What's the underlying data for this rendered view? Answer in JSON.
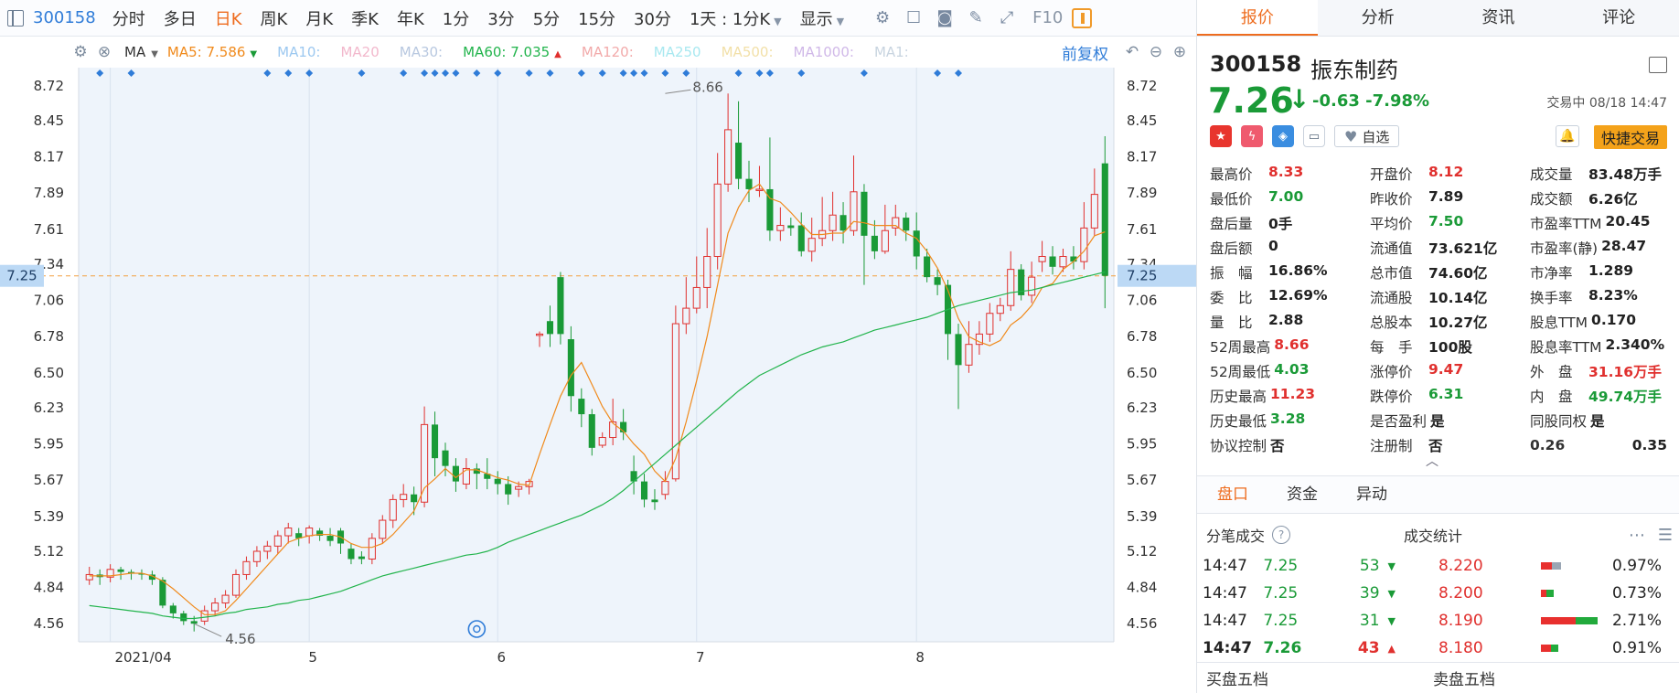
{
  "toolbar": {
    "code": "300158",
    "timeframes": [
      {
        "label": "分时",
        "active": false
      },
      {
        "label": "多日",
        "active": false
      },
      {
        "label": "日K",
        "active": true
      },
      {
        "label": "周K",
        "active": false
      },
      {
        "label": "月K",
        "active": false
      },
      {
        "label": "季K",
        "active": false
      },
      {
        "label": "年K",
        "active": false
      },
      {
        "label": "1分",
        "active": false
      },
      {
        "label": "3分",
        "active": false
      },
      {
        "label": "5分",
        "active": false
      },
      {
        "label": "15分",
        "active": false
      },
      {
        "label": "30分",
        "active": false
      }
    ],
    "period_select": "1天 : 1分K",
    "display_label": "显示",
    "f10": "F10"
  },
  "ma_bar": {
    "indicator": "MA",
    "items": [
      {
        "label": "MA5: 7.586",
        "color": "#f08a1c",
        "arrow": "down"
      },
      {
        "label": "MA10:",
        "color": "#9cc8f0"
      },
      {
        "label": "MA20",
        "color": "#f2b8cc"
      },
      {
        "label": "MA30:",
        "color": "#b8c8e0"
      },
      {
        "label": "MA60: 7.035",
        "color": "#22b44c",
        "arrow": "up"
      },
      {
        "label": "MA120:",
        "color": "#f2aaaa"
      },
      {
        "label": "MA250",
        "color": "#a8e8f0"
      },
      {
        "label": "MA500:",
        "color": "#f2e0a8"
      },
      {
        "label": "MA1000:",
        "color": "#d0b8e8"
      },
      {
        "label": "MA1:",
        "color": "#c8d4e0"
      }
    ],
    "adjust_label": "前复权"
  },
  "chart_data": {
    "type": "candlestick",
    "y_ticks": [
      "8.72",
      "8.45",
      "8.17",
      "7.89",
      "7.61",
      "7.34",
      "7.06",
      "6.78",
      "6.50",
      "6.23",
      "5.95",
      "5.67",
      "5.39",
      "5.12",
      "4.84",
      "4.56"
    ],
    "ylim": [
      4.42,
      8.86
    ],
    "x_labels": [
      {
        "label": "2021/04",
        "idx": 2
      },
      {
        "label": "5",
        "idx": 21
      },
      {
        "label": "6",
        "idx": 39
      },
      {
        "label": "7",
        "idx": 58
      },
      {
        "label": "8",
        "idx": 79
      }
    ],
    "current_price": "7.25",
    "current_value": 7.25,
    "high_label": "8.66",
    "high_value": 8.66,
    "high_idx": 55,
    "low_label": "4.56",
    "low_value": 4.56,
    "low_idx": 10,
    "candles": [
      [
        4.9,
        4.94,
        4.86,
        5.0
      ],
      [
        4.94,
        4.92,
        4.86,
        4.98
      ],
      [
        4.92,
        4.98,
        4.88,
        5.02
      ],
      [
        4.98,
        4.96,
        4.9,
        5.0
      ],
      [
        4.96,
        4.95,
        4.9,
        4.98
      ],
      [
        4.95,
        4.94,
        4.9,
        4.98
      ],
      [
        4.94,
        4.9,
        4.86,
        4.97
      ],
      [
        4.9,
        4.7,
        4.68,
        4.92
      ],
      [
        4.7,
        4.64,
        4.6,
        4.72
      ],
      [
        4.64,
        4.58,
        4.55,
        4.66
      ],
      [
        4.58,
        4.56,
        4.5,
        4.62
      ],
      [
        4.58,
        4.66,
        4.55,
        4.7
      ],
      [
        4.66,
        4.72,
        4.62,
        4.76
      ],
      [
        4.72,
        4.78,
        4.68,
        4.82
      ],
      [
        4.78,
        4.94,
        4.76,
        4.98
      ],
      [
        4.94,
        5.04,
        4.9,
        5.08
      ],
      [
        5.04,
        5.12,
        5.0,
        5.16
      ],
      [
        5.12,
        5.16,
        5.06,
        5.2
      ],
      [
        5.16,
        5.24,
        5.1,
        5.28
      ],
      [
        5.24,
        5.3,
        5.18,
        5.34
      ],
      [
        5.26,
        5.22,
        5.16,
        5.3
      ],
      [
        5.24,
        5.3,
        5.18,
        5.32
      ],
      [
        5.28,
        5.24,
        5.2,
        5.3
      ],
      [
        5.24,
        5.2,
        5.16,
        5.3
      ],
      [
        5.28,
        5.18,
        5.1,
        5.3
      ],
      [
        5.14,
        5.06,
        5.02,
        5.18
      ],
      [
        5.08,
        5.06,
        5.02,
        5.12
      ],
      [
        5.06,
        5.22,
        5.02,
        5.26
      ],
      [
        5.22,
        5.36,
        5.18,
        5.4
      ],
      [
        5.36,
        5.52,
        5.3,
        5.56
      ],
      [
        5.52,
        5.56,
        5.46,
        5.64
      ],
      [
        5.56,
        5.5,
        5.4,
        5.62
      ],
      [
        5.5,
        6.1,
        5.46,
        6.24
      ],
      [
        6.1,
        5.84,
        5.7,
        6.2
      ],
      [
        5.9,
        5.78,
        5.7,
        5.96
      ],
      [
        5.78,
        5.66,
        5.58,
        5.84
      ],
      [
        5.64,
        5.76,
        5.6,
        5.84
      ],
      [
        5.76,
        5.72,
        5.6,
        5.8
      ],
      [
        5.72,
        5.68,
        5.6,
        5.84
      ],
      [
        5.68,
        5.64,
        5.56,
        5.74
      ],
      [
        5.64,
        5.56,
        5.48,
        5.7
      ],
      [
        5.6,
        5.62,
        5.54,
        5.66
      ],
      [
        5.62,
        5.66,
        5.56,
        5.68
      ],
      [
        6.8,
        6.8,
        6.7,
        6.82
      ],
      [
        6.9,
        6.8,
        6.7,
        7.02
      ],
      [
        7.24,
        6.8,
        6.72,
        7.28
      ],
      [
        6.76,
        6.32,
        6.2,
        6.86
      ],
      [
        6.3,
        6.18,
        6.08,
        6.38
      ],
      [
        6.18,
        5.92,
        5.86,
        6.22
      ],
      [
        5.94,
        6.0,
        5.92,
        6.04
      ],
      [
        6.0,
        6.12,
        5.94,
        6.3
      ],
      [
        6.12,
        6.04,
        5.98,
        6.22
      ],
      [
        5.74,
        5.66,
        5.56,
        5.86
      ],
      [
        5.66,
        5.52,
        5.46,
        5.72
      ],
      [
        5.52,
        5.5,
        5.44,
        5.6
      ],
      [
        5.56,
        5.66,
        5.52,
        5.74
      ],
      [
        5.68,
        6.88,
        5.66,
        7.02
      ],
      [
        6.88,
        7.0,
        6.8,
        7.24
      ],
      [
        7.0,
        7.16,
        6.96,
        7.4
      ],
      [
        7.16,
        7.4,
        7.0,
        7.62
      ],
      [
        7.4,
        7.96,
        7.3,
        8.2
      ],
      [
        7.96,
        8.38,
        7.9,
        8.66
      ],
      [
        8.28,
        8.0,
        7.92,
        8.6
      ],
      [
        8.0,
        7.92,
        7.82,
        8.14
      ],
      [
        7.92,
        7.92,
        7.86,
        8.1
      ],
      [
        7.92,
        7.6,
        7.52,
        8.32
      ],
      [
        7.6,
        7.64,
        7.52,
        7.78
      ],
      [
        7.64,
        7.62,
        7.56,
        7.7
      ],
      [
        7.64,
        7.44,
        7.4,
        7.74
      ],
      [
        7.44,
        7.54,
        7.36,
        7.7
      ],
      [
        7.54,
        7.6,
        7.48,
        7.86
      ],
      [
        7.6,
        7.72,
        7.52,
        7.9
      ],
      [
        7.72,
        7.6,
        7.5,
        7.82
      ],
      [
        7.6,
        7.9,
        7.56,
        8.18
      ],
      [
        7.9,
        7.56,
        7.18,
        7.96
      ],
      [
        7.56,
        7.44,
        7.38,
        7.68
      ],
      [
        7.44,
        7.6,
        7.42,
        7.8
      ],
      [
        7.62,
        7.7,
        7.56,
        7.8
      ],
      [
        7.7,
        7.6,
        7.52,
        7.74
      ],
      [
        7.6,
        7.4,
        7.3,
        7.74
      ],
      [
        7.4,
        7.24,
        7.2,
        7.46
      ],
      [
        7.24,
        7.18,
        7.1,
        7.3
      ],
      [
        7.18,
        6.8,
        6.6,
        7.22
      ],
      [
        6.8,
        6.56,
        6.22,
        6.88
      ],
      [
        6.56,
        6.72,
        6.5,
        6.9
      ],
      [
        6.72,
        6.8,
        6.64,
        6.9
      ],
      [
        6.8,
        6.96,
        6.74,
        7.04
      ],
      [
        6.96,
        7.02,
        6.9,
        7.08
      ],
      [
        7.02,
        7.3,
        6.98,
        7.44
      ],
      [
        7.3,
        7.1,
        7.06,
        7.34
      ],
      [
        7.1,
        7.24,
        7.04,
        7.36
      ],
      [
        7.36,
        7.4,
        7.28,
        7.52
      ],
      [
        7.4,
        7.32,
        7.26,
        7.48
      ],
      [
        7.32,
        7.4,
        7.28,
        7.46
      ],
      [
        7.4,
        7.36,
        7.3,
        7.48
      ],
      [
        7.36,
        7.62,
        7.3,
        7.82
      ],
      [
        7.62,
        7.88,
        7.56,
        8.08
      ],
      [
        8.12,
        7.25,
        7.0,
        8.33
      ]
    ],
    "ma5": [
      4.93,
      4.93,
      4.93,
      4.94,
      4.95,
      4.95,
      4.93,
      4.89,
      4.83,
      4.76,
      4.69,
      4.63,
      4.63,
      4.66,
      4.74,
      4.83,
      4.92,
      5.01,
      5.1,
      5.19,
      5.22,
      5.24,
      5.25,
      5.25,
      5.23,
      5.18,
      5.15,
      5.15,
      5.18,
      5.25,
      5.34,
      5.43,
      5.61,
      5.68,
      5.76,
      5.69,
      5.75,
      5.75,
      5.72,
      5.69,
      5.67,
      5.64,
      5.63,
      5.87,
      6.1,
      6.32,
      6.48,
      6.58,
      6.41,
      6.24,
      6.11,
      6.05,
      5.95,
      5.87,
      5.74,
      5.66,
      5.84,
      6.12,
      6.44,
      6.78,
      7.18,
      7.58,
      7.78,
      7.91,
      7.96,
      7.85,
      7.82,
      7.74,
      7.65,
      7.57,
      7.57,
      7.58,
      7.58,
      7.67,
      7.66,
      7.64,
      7.64,
      7.64,
      7.58,
      7.54,
      7.44,
      7.31,
      7.14,
      6.92,
      6.78,
      6.74,
      6.71,
      6.75,
      6.87,
      6.93,
      7.02,
      7.16,
      7.19,
      7.3,
      7.36,
      7.44,
      7.56,
      7.59
    ],
    "ma60": [
      4.7,
      4.69,
      4.68,
      4.67,
      4.66,
      4.65,
      4.64,
      4.62,
      4.61,
      4.6,
      4.6,
      4.61,
      4.62,
      4.64,
      4.65,
      4.67,
      4.68,
      4.69,
      4.71,
      4.72,
      4.74,
      4.75,
      4.77,
      4.79,
      4.81,
      4.84,
      4.87,
      4.9,
      4.93,
      4.95,
      4.97,
      4.99,
      5.01,
      5.03,
      5.05,
      5.07,
      5.09,
      5.1,
      5.12,
      5.15,
      5.19,
      5.22,
      5.25,
      5.28,
      5.31,
      5.34,
      5.37,
      5.4,
      5.44,
      5.48,
      5.53,
      5.59,
      5.66,
      5.73,
      5.8,
      5.87,
      5.94,
      6.01,
      6.08,
      6.15,
      6.22,
      6.29,
      6.36,
      6.42,
      6.48,
      6.52,
      6.56,
      6.6,
      6.64,
      6.67,
      6.7,
      6.72,
      6.74,
      6.77,
      6.8,
      6.83,
      6.85,
      6.87,
      6.89,
      6.91,
      6.93,
      6.96,
      6.99,
      7.02,
      7.04,
      7.06,
      7.08,
      7.1,
      7.12,
      7.13,
      7.14,
      7.16,
      7.18,
      7.2,
      7.22,
      7.24,
      7.26,
      7.28
    ],
    "event_marker_idx": 37
  },
  "right": {
    "tabs": [
      {
        "label": "报价",
        "active": true
      },
      {
        "label": "分析",
        "active": false
      },
      {
        "label": "资讯",
        "active": false
      },
      {
        "label": "评论",
        "active": false
      }
    ],
    "code": "300158",
    "name": "振东制药",
    "price": "7.26",
    "change": "-0.63 -7.98%",
    "status": "交易中 08/18 14:47",
    "watch_label": "自选",
    "quick_trade": "快捷交易",
    "stats": [
      [
        {
          "l": "最高价",
          "v": "8.33",
          "c": "red"
        },
        {
          "l": "开盘价",
          "v": "8.12",
          "c": "red"
        },
        {
          "l": "成交量",
          "v": "83.48万手",
          "c": "dark"
        }
      ],
      [
        {
          "l": "最低价",
          "v": "7.00",
          "c": "green"
        },
        {
          "l": "昨收价",
          "v": "7.89",
          "c": "dark"
        },
        {
          "l": "成交额",
          "v": "6.26亿",
          "c": "dark"
        }
      ],
      [
        {
          "l": "盘后量",
          "v": "0手",
          "c": "dark"
        },
        {
          "l": "平均价",
          "v": "7.50",
          "c": "green"
        },
        {
          "l": "市盈率TTM",
          "v": "20.45",
          "c": "dark"
        }
      ],
      [
        {
          "l": "盘后额",
          "v": "0",
          "c": "dark"
        },
        {
          "l": "流通值",
          "v": "73.621亿",
          "c": "dark"
        },
        {
          "l": "市盈率(静)",
          "v": "28.47",
          "c": "dark"
        }
      ],
      [
        {
          "l": "振　幅",
          "v": "16.86%",
          "c": "dark"
        },
        {
          "l": "总市值",
          "v": "74.60亿",
          "c": "dark"
        },
        {
          "l": "市净率",
          "v": "1.289",
          "c": "dark"
        }
      ],
      [
        {
          "l": "委　比",
          "v": "12.69%",
          "c": "dark"
        },
        {
          "l": "流通股",
          "v": "10.14亿",
          "c": "dark"
        },
        {
          "l": "换手率",
          "v": "8.23%",
          "c": "dark"
        }
      ],
      [
        {
          "l": "量　比",
          "v": "2.88",
          "c": "dark"
        },
        {
          "l": "总股本",
          "v": "10.27亿",
          "c": "dark"
        },
        {
          "l": "股息TTM",
          "v": "0.170",
          "c": "dark"
        }
      ],
      [
        {
          "l": "52周最高",
          "v": "8.66",
          "c": "red"
        },
        {
          "l": "每　手",
          "v": "100股",
          "c": "dark"
        },
        {
          "l": "股息率TTM",
          "v": "2.340%",
          "c": "dark"
        }
      ],
      [
        {
          "l": "52周最低",
          "v": "4.03",
          "c": "green"
        },
        {
          "l": "涨停价",
          "v": "9.47",
          "c": "red"
        },
        {
          "l": "外　盘",
          "v": "31.16万手",
          "c": "red"
        }
      ],
      [
        {
          "l": "历史最高",
          "v": "11.23",
          "c": "red"
        },
        {
          "l": "跌停价",
          "v": "6.31",
          "c": "green"
        },
        {
          "l": "内　盘",
          "v": "49.74万手",
          "c": "green"
        }
      ],
      [
        {
          "l": "历史最低",
          "v": "3.28",
          "c": "green"
        },
        {
          "l": "是否盈利",
          "v": "是",
          "c": "dark"
        },
        {
          "l": "同股同权",
          "v": "是",
          "c": "dark"
        }
      ],
      [
        {
          "l": "协议控制",
          "v": "否",
          "c": "dark"
        },
        {
          "l": "注册制",
          "v": "否",
          "c": "dark"
        },
        {
          "l": "0.26",
          "v": "0.35",
          "c": "dark"
        }
      ]
    ],
    "sub_tabs": [
      {
        "label": "盘口",
        "active": true
      },
      {
        "label": "资金",
        "active": false
      },
      {
        "label": "异动",
        "active": false
      }
    ],
    "ticks_title": "分笔成交",
    "dist_title": "成交统计",
    "ticks": [
      {
        "t": "14:47",
        "p": "7.25",
        "v": "53",
        "dir": "down",
        "bold": false
      },
      {
        "t": "14:47",
        "p": "7.25",
        "v": "39",
        "dir": "down",
        "bold": false
      },
      {
        "t": "14:47",
        "p": "7.25",
        "v": "31",
        "dir": "down",
        "bold": false
      },
      {
        "t": "14:47",
        "p": "7.26",
        "v": "43",
        "dir": "up",
        "bold": true
      }
    ],
    "dist": [
      {
        "price": "8.220",
        "pct": "0.97%",
        "red": 0.2,
        "green": 0.0,
        "gray": 0.15
      },
      {
        "price": "8.200",
        "pct": "0.73%",
        "red": 0.1,
        "green": 0.12,
        "gray": 0.0
      },
      {
        "price": "8.190",
        "pct": "2.71%",
        "red": 0.62,
        "green": 0.38,
        "gray": 0.0
      },
      {
        "price": "8.180",
        "pct": "0.91%",
        "red": 0.18,
        "green": 0.12,
        "gray": 0.0
      }
    ],
    "buy5": "买盘五档",
    "sell5": "卖盘五档"
  },
  "colors": {
    "up": "#e0302e",
    "down": "#1a9a37",
    "ma5": "#f08a1c",
    "ma60": "#22b44c",
    "price_line": "#f2a040",
    "blue": "#2f7cd8"
  }
}
